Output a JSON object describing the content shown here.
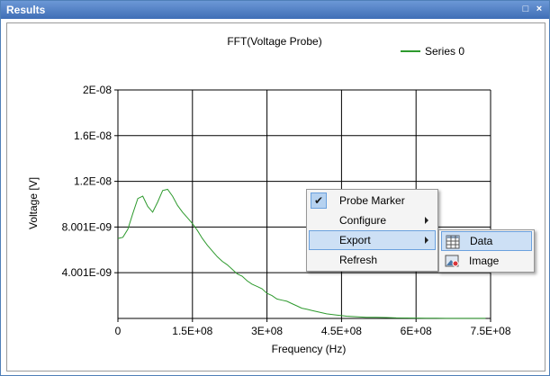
{
  "window": {
    "title": "Results",
    "controls": {
      "maximize": "□",
      "close": "×"
    }
  },
  "chart_data": {
    "type": "line",
    "title": "FFT(Voltage Probe)",
    "xlabel": "Frequency (Hz)",
    "ylabel": "Voltage [V]",
    "xlim": [
      0,
      750000000
    ],
    "ylim": [
      0,
      2e-08
    ],
    "xticks": [
      0,
      150000000,
      300000000,
      450000000,
      600000000,
      750000000
    ],
    "xtick_labels": [
      "0",
      "1.5E+08",
      "3E+08",
      "4.5E+08",
      "6E+08",
      "7.5E+08"
    ],
    "yticks": [
      4.001e-09,
      8.001e-09,
      1.2e-08,
      1.6e-08,
      2e-08
    ],
    "ytick_labels": [
      "4.001E-09",
      "8.001E-09",
      "1.2E-08",
      "1.6E-08",
      "2E-08"
    ],
    "grid": true,
    "legend": "top-right",
    "series": [
      {
        "name": "Series 0",
        "color": "#2e9a2e",
        "x": [
          0,
          10000000,
          20000000,
          30000000,
          40000000,
          50000000,
          60000000,
          70000000,
          80000000,
          90000000,
          100000000,
          110000000,
          120000000,
          130000000,
          140000000,
          150000000,
          160000000,
          170000000,
          180000000,
          190000000,
          200000000,
          210000000,
          220000000,
          230000000,
          240000000,
          250000000,
          260000000,
          270000000,
          280000000,
          290000000,
          300000000,
          310000000,
          320000000,
          330000000,
          340000000,
          350000000,
          360000000,
          370000000,
          380000000,
          390000000,
          400000000,
          420000000,
          440000000,
          460000000,
          480000000,
          500000000,
          520000000,
          540000000,
          560000000,
          580000000,
          600000000,
          620000000,
          640000000,
          660000000,
          680000000,
          700000000,
          720000000,
          740000000
        ],
        "y": [
          7e-09,
          7.1e-09,
          7.8e-09,
          9.2e-09,
          1.05e-08,
          1.07e-08,
          9.8e-09,
          9.3e-09,
          1.02e-08,
          1.12e-08,
          1.13e-08,
          1.07e-08,
          9.9e-09,
          9.3e-09,
          8.8e-09,
          8.3e-09,
          7.7e-09,
          7e-09,
          6.4e-09,
          5.9e-09,
          5.4e-09,
          5e-09,
          4.7e-09,
          4.3e-09,
          3.9e-09,
          3.7e-09,
          3.3e-09,
          3e-09,
          2.8e-09,
          2.6e-09,
          2.2e-09,
          2e-09,
          1.7e-09,
          1.6e-09,
          1.5e-09,
          1.3e-09,
          1.1e-09,
          9e-10,
          8e-10,
          7e-10,
          6e-10,
          4e-10,
          3e-10,
          2e-10,
          1.5e-10,
          1e-10,
          1e-10,
          8e-11,
          5e-11,
          4e-11,
          3e-11,
          2e-11,
          2e-11,
          1e-11,
          1e-11,
          1e-11,
          5e-12,
          5e-12
        ]
      }
    ]
  },
  "context_menu": {
    "items": [
      {
        "label": "Probe Marker",
        "checked": true
      },
      {
        "label": "Configure",
        "submenu": true
      },
      {
        "label": "Export",
        "submenu": true,
        "highlighted": true
      },
      {
        "label": "Refresh"
      }
    ]
  },
  "export_submenu": {
    "items": [
      {
        "label": "Data",
        "icon": "data-table-icon",
        "highlighted": true
      },
      {
        "label": "Image",
        "icon": "image-icon"
      }
    ]
  }
}
